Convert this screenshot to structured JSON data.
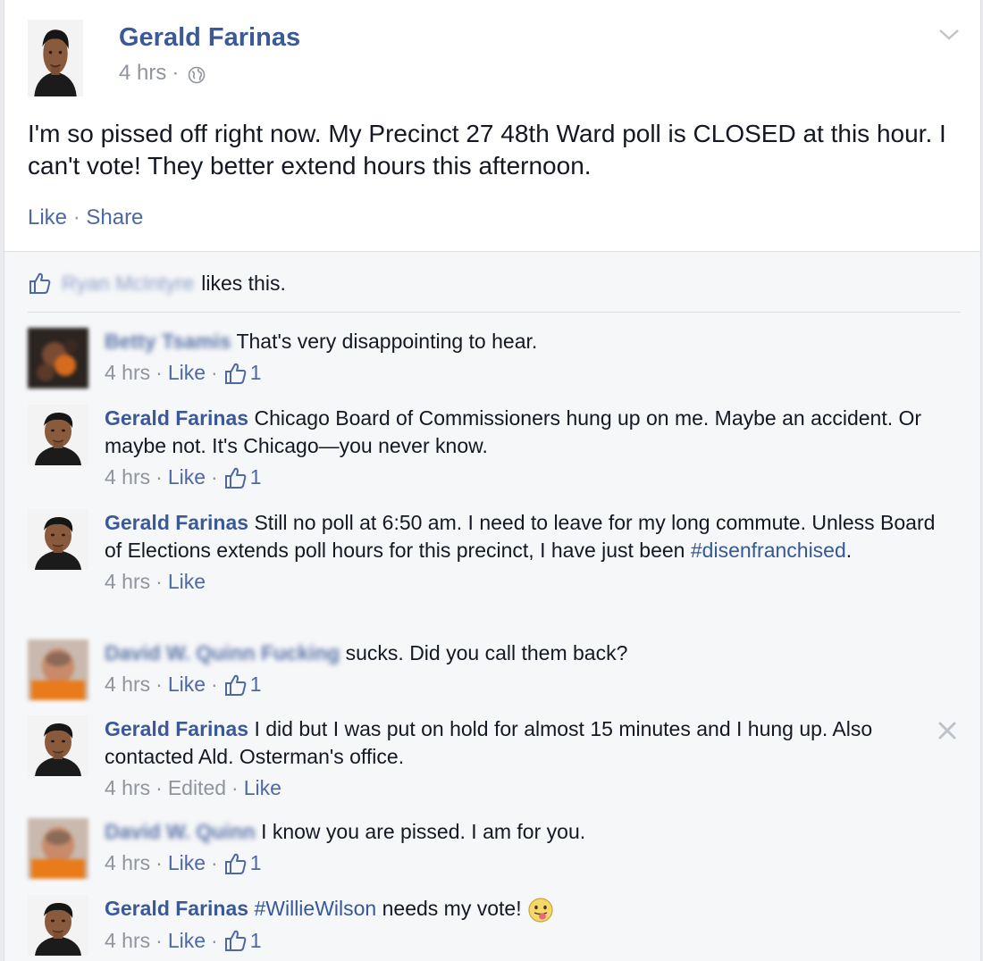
{
  "post": {
    "author": "Gerald Farinas",
    "time": "4 hrs",
    "meta_sep": "·",
    "privacy_icon": "globe-icon",
    "text": "I'm so pissed off right now. My Precinct 27 48th Ward poll is CLOSED at this hour. I can't vote! They better extend hours this afternoon.",
    "like_label": "Like",
    "actions_sep": " · ",
    "share_label": "Share"
  },
  "likes": {
    "name": "Ryan McIntyre",
    "suffix": "likes this."
  },
  "comments": [
    {
      "author": "Betty Tsamis",
      "author_blurred": true,
      "text": "That's very disappointing to hear.",
      "time": "4 hrs",
      "like_label": "Like",
      "likes": "1"
    },
    {
      "author": "Gerald Farinas",
      "author_blurred": false,
      "text": "Chicago Board of Commissioners hung up on me. Maybe an accident. Or maybe not. It's Chicago—you never know.",
      "time": "4 hrs",
      "like_label": "Like",
      "likes": "1"
    },
    {
      "author": "Gerald Farinas",
      "author_blurred": false,
      "text": "Still no poll at 6:50 am. I need to leave for my long commute. Unless Board of Elections extends poll hours for this precinct, I have just been",
      "hashtag": "#disenfranchised",
      "text_after": ".",
      "time": "4 hrs",
      "like_label": "Like"
    },
    {
      "author": "David W. Quinn Fucking",
      "author_blurred": true,
      "text": "sucks. Did you call them back?",
      "time": "4 hrs",
      "like_label": "Like",
      "likes": "1"
    },
    {
      "author": "Gerald Farinas",
      "author_blurred": false,
      "text": "I did but I was put on hold for almost 15 minutes and I hung up. Also contacted Ald. Osterman's office.",
      "time": "4 hrs",
      "edited_label": "Edited",
      "like_label": "Like"
    },
    {
      "author": "David W. Quinn",
      "author_blurred": true,
      "text": "I know you are pissed. I am for you.",
      "time": "4 hrs",
      "like_label": "Like",
      "likes": "1"
    },
    {
      "author": "Gerald Farinas",
      "author_blurred": false,
      "hashtag": "#WillieWilson",
      "text": "needs my vote!",
      "emoji": "tongue-out-emoji",
      "time": "4 hrs",
      "like_label": "Like",
      "likes": "1"
    }
  ],
  "colors": {
    "link_blue": "#3b5998",
    "meta_gray": "#90949c",
    "feedback_bg": "#f6f7f9"
  }
}
